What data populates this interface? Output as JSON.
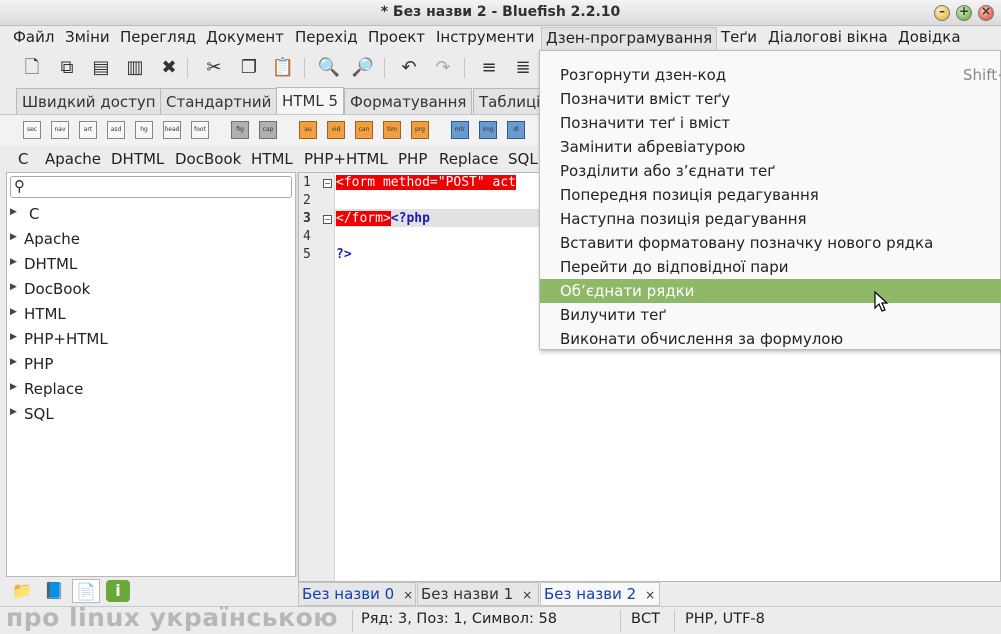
{
  "window": {
    "title": "* Без назви 2 - Bluefish 2.2.10",
    "minimize": "–",
    "maximize": "+",
    "close": "×"
  },
  "menubar": [
    "Файл",
    "Зміни",
    "Перегляд",
    "Документ",
    "Перехід",
    "Проект",
    "Інструменти",
    "Дзен-програмування",
    "Теґи",
    "Діалогові вікна",
    "Довідка"
  ],
  "toolbar": {
    "icons": [
      "new-file-icon",
      "open-file-icon",
      "save-icon",
      "save-as-icon",
      "close-doc-icon",
      "cut-icon",
      "copy-icon",
      "paste-icon",
      "find-icon",
      "find-replace-icon",
      "undo-icon",
      "redo-icon",
      "indent-icon",
      "unindent-icon"
    ]
  },
  "panel_tabs": [
    "Швидкий доступ",
    "Стандартний",
    "HTML 5",
    "Форматування",
    "Таблиці"
  ],
  "html5_icons": [
    "sec",
    "nav",
    "art",
    "asd",
    "hg",
    "head",
    "foot",
    "fig",
    "cap",
    "au",
    "vid",
    "can",
    "tim",
    "prg",
    "mtr",
    "img",
    "dl"
  ],
  "filter_bar": [
    "C",
    "Apache",
    "DHTML",
    "DocBook",
    "HTML",
    "PHP+HTML",
    "PHP",
    "Replace",
    "SQL"
  ],
  "sidebar": {
    "search_placeholder": "",
    "items": [
      "C",
      "Apache",
      "DHTML",
      "DocBook",
      "HTML",
      "PHP+HTML",
      "PHP",
      "Replace",
      "SQL"
    ],
    "bottom_tabs": [
      "folder-icon",
      "bookmarks-icon",
      "snippets-icon",
      "info-icon"
    ]
  },
  "editor": {
    "line_numbers": [
      "1",
      "2",
      "3",
      "4",
      "5"
    ],
    "lines": {
      "l1_tag": "<form method=\"POST\" act",
      "l3_tag": "</form>",
      "l3_php": "<?php",
      "l5_php": "?>"
    }
  },
  "doc_tabs": [
    {
      "label": "Без назви 0",
      "close": "×"
    },
    {
      "label": "Без назви 1",
      "close": "×"
    },
    {
      "label": "Без назви 2",
      "close": "×"
    }
  ],
  "statusbar": {
    "watermark": "про linux українською",
    "position": "Ряд: 3, Поз: 1, Символ: 58",
    "mode": "ВСТ",
    "encoding": "PHP, UTF-8"
  },
  "zen_menu": {
    "items": [
      {
        "label": "Розгорнути дзен-код",
        "accel": "Shift+"
      },
      {
        "label": "Позначити вміст теґу"
      },
      {
        "label": "Позначити теґ і вміст"
      },
      {
        "label": "Замінити абревіатурою"
      },
      {
        "label": "Розділити або з’єднати теґ"
      },
      {
        "label": "Попередня позиція редагування"
      },
      {
        "label": "Наступна позиція редагування"
      },
      {
        "label": "Вставити форматовану позначку нового рядка"
      },
      {
        "label": "Перейти до відповідної пари"
      },
      {
        "label": "Об’єднати рядки"
      },
      {
        "label": "Вилучити теґ"
      },
      {
        "label": "Виконати обчислення за формулою"
      }
    ]
  },
  "colors": {
    "menu_highlight": "#8fb868",
    "tag_highlight": "#ee0000",
    "php_keyword": "#1a1ab8"
  }
}
